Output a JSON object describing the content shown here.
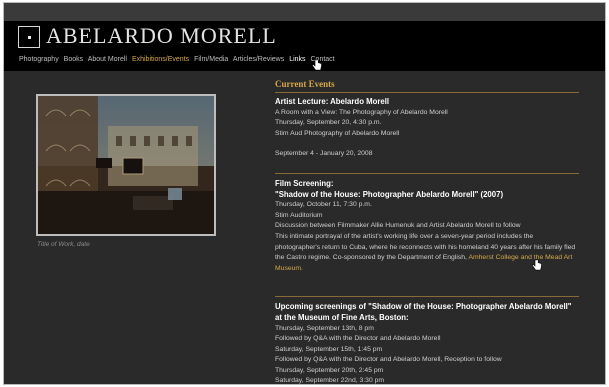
{
  "site": {
    "title": "ABELARDO MORELL"
  },
  "nav": {
    "items": [
      "Photography",
      "Books",
      "About Morell",
      "Exhibitions/Events",
      "Film/Media",
      "Articles/Reviews",
      "Links",
      "Contact"
    ],
    "active_index": 3,
    "hover_index": 6
  },
  "colors": {
    "accent": "#d7a74a",
    "background": "#2a2a2a",
    "header": "#000000"
  },
  "photo": {
    "caption": "Title of Work, date"
  },
  "current_events": {
    "heading": "Current Events",
    "events": [
      {
        "title": "Artist Lecture: Abelardo Morell",
        "lines": [
          "A Room with a View: The Photography of Abelardo Morell",
          "Thursday, September 20, 4:30 p.m.",
          "Stim Aud  Photography of Abelardo Morell"
        ],
        "dates": "September 4 - January 20, 2008"
      },
      {
        "title_lines": [
          "Film Screening:",
          "\"Shadow of the House: Photographer Abelardo Morell\" (2007)"
        ],
        "lines": [
          "Thursday, October 11, 7:30 p.m.",
          "Stim Auditorium",
          "Discussion between Filmmaker Allie Humenuk and Artist Abelardo Morell to follow"
        ],
        "description": "This intimate portrayal of the artist's working life over a seven-year period includes the photographer's return to Cuba, where he reconnects with his homeland 40 years after his family fled the Castro regime. Co-sponsored by the Department of English, ",
        "link_text": "Amherst College and the Mead Art Museum."
      },
      {
        "title_lines": [
          "Upcoming screenings of \"Shadow of the House: Photographer Abelardo Morell\"",
          "at the Museum of Fine Arts, Boston:"
        ],
        "lines": [
          "Thursday, September 13th, 8 pm",
          "Followed by Q&A with the Director and Abelardo Morell",
          "Saturday, September 15th, 1:45 pm",
          "Followed by Q&A with the Director and Abelardo Morell, Reception to follow",
          "Thursday, September 20th, 2:45 pm",
          "Saturday, September 22nd, 3:30 pm"
        ]
      }
    ]
  }
}
